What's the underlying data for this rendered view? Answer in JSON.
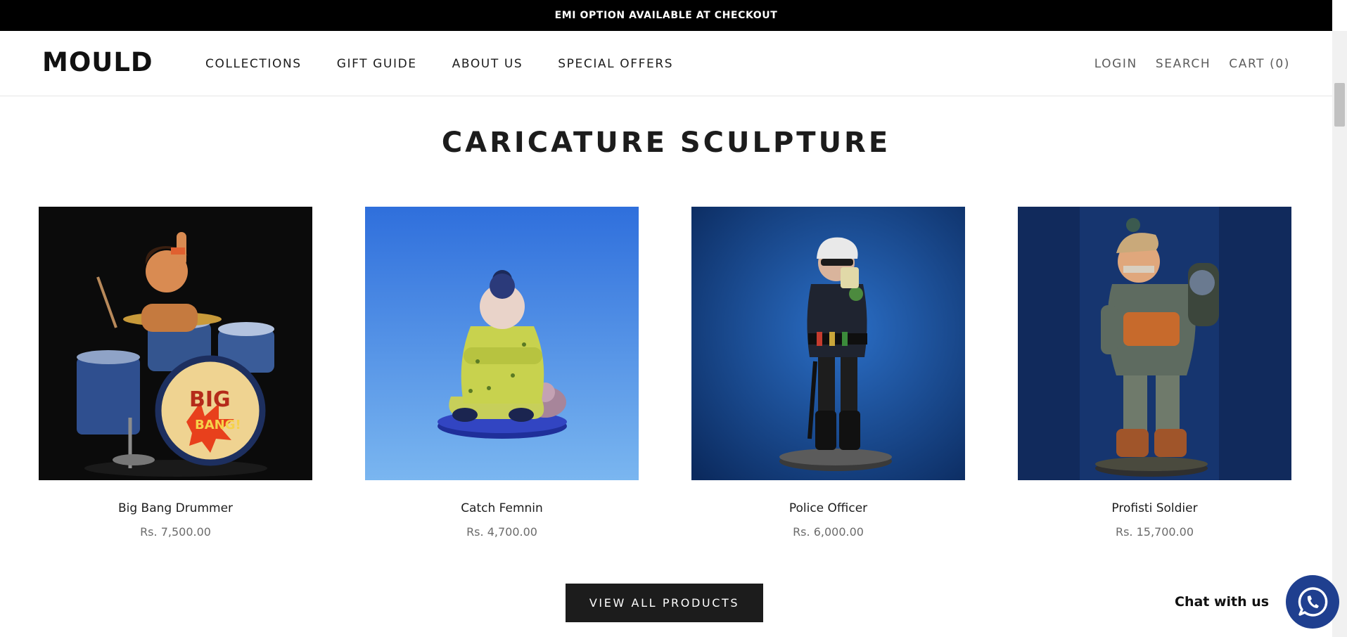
{
  "announcement": {
    "text": "EMI OPTION AVAILABLE AT CHECKOUT"
  },
  "header": {
    "logo": "MOULD",
    "nav": [
      {
        "label": "COLLECTIONS"
      },
      {
        "label": "GIFT GUIDE"
      },
      {
        "label": "ABOUT US"
      },
      {
        "label": "SPECIAL OFFERS"
      }
    ],
    "login_label": "LOGIN",
    "search_label": "SEARCH",
    "cart_label": "CART (0)"
  },
  "section": {
    "title": "CARICATURE SCULPTURE"
  },
  "products": [
    {
      "name": "Big Bang Drummer",
      "price": "Rs. 7,500.00"
    },
    {
      "name": "Catch Femnin",
      "price": "Rs. 4,700.00"
    },
    {
      "name": "Police Officer",
      "price": "Rs. 6,000.00"
    },
    {
      "name": "Profisti Soldier",
      "price": "Rs. 15,700.00"
    }
  ],
  "view_all_label": "VIEW ALL PRODUCTS",
  "chat": {
    "label": "Chat with us",
    "icon": "whatsapp-icon"
  },
  "colors": {
    "announcement_bg": "#000000",
    "button_bg": "#1c1c1c",
    "chat_bubble": "#1f3f8f"
  }
}
